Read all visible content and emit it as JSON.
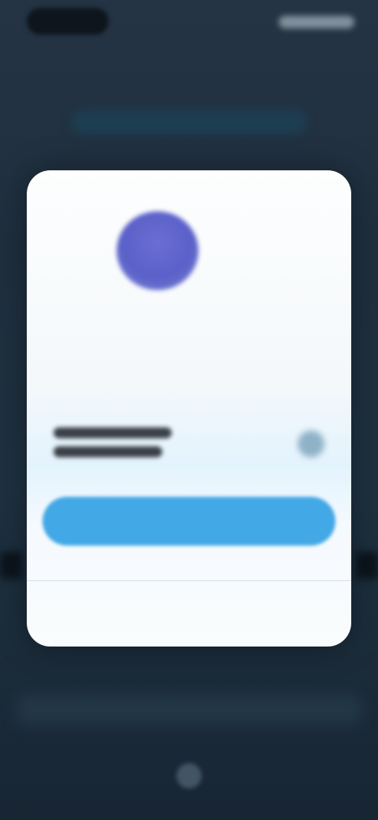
{
  "status_bar": {
    "time": "",
    "indicators": [
      "signal-icon",
      "wifi-icon",
      "battery-icon"
    ]
  },
  "background": {
    "title": ""
  },
  "dialog": {
    "icon": "app-logo-icon",
    "title": "",
    "message": "",
    "field": {
      "line1": "",
      "line2": "",
      "icon": "eye-icon"
    },
    "primary_button_label": "",
    "footer_link": ""
  },
  "colors": {
    "background": "#1f2f3e",
    "dialog": "#fdfefe",
    "accent": "#43a8e6",
    "logo": "#5a60c8"
  }
}
